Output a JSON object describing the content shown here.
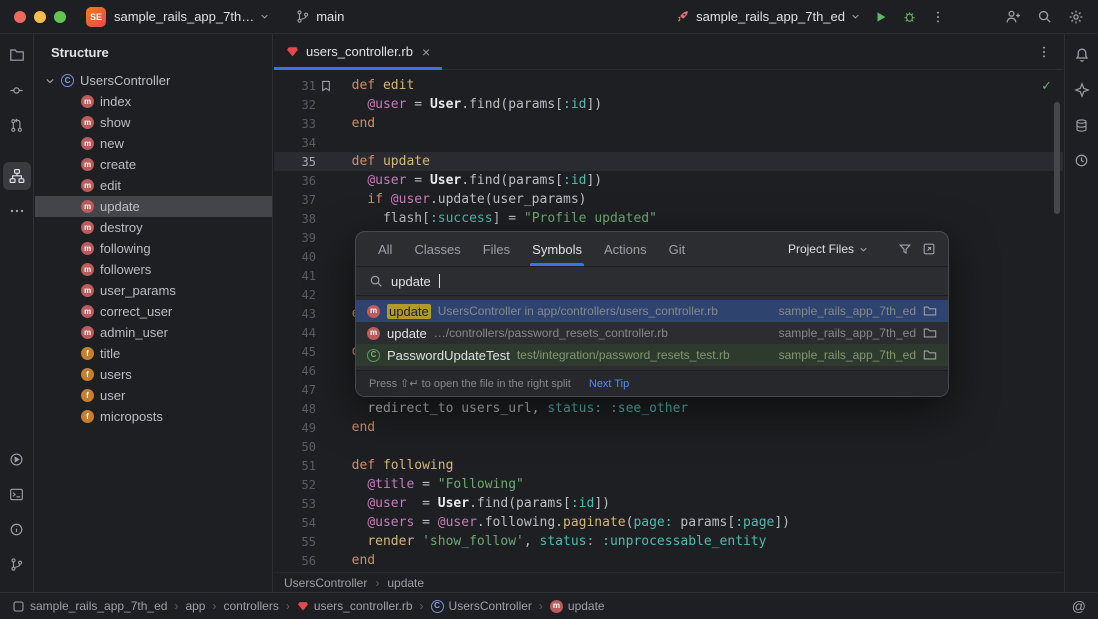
{
  "titlebar": {
    "project_badge": "SE",
    "project_name": "sample_rails_app_7th…",
    "branch": "main",
    "run_config": "sample_rails_app_7th_ed"
  },
  "icons": {
    "left_stripe_top": [
      "project",
      "commit",
      "pull-requests",
      "structure",
      "more"
    ],
    "left_stripe_bottom": [
      "run",
      "terminal",
      "problems",
      "git"
    ],
    "right_stripe": [
      "notifications",
      "ai-assistant",
      "database",
      "history"
    ],
    "titlebar_right": [
      "run-config",
      "run",
      "debug",
      "more",
      "add-user",
      "search",
      "settings"
    ]
  },
  "structure": {
    "title": "Structure",
    "root": {
      "label": "UsersController",
      "icon": "class"
    },
    "items": [
      {
        "label": "index",
        "icon": "method"
      },
      {
        "label": "show",
        "icon": "method"
      },
      {
        "label": "new",
        "icon": "method"
      },
      {
        "label": "create",
        "icon": "method"
      },
      {
        "label": "edit",
        "icon": "method"
      },
      {
        "label": "update",
        "icon": "method",
        "selected": true
      },
      {
        "label": "destroy",
        "icon": "method"
      },
      {
        "label": "following",
        "icon": "method"
      },
      {
        "label": "followers",
        "icon": "method"
      },
      {
        "label": "user_params",
        "icon": "method"
      },
      {
        "label": "correct_user",
        "icon": "method"
      },
      {
        "label": "admin_user",
        "icon": "method"
      },
      {
        "label": "title",
        "icon": "field"
      },
      {
        "label": "users",
        "icon": "field"
      },
      {
        "label": "user",
        "icon": "field"
      },
      {
        "label": "microposts",
        "icon": "field"
      }
    ]
  },
  "editor": {
    "tab_label": "users_controller.rb",
    "breadcrumb": {
      "class": "UsersController",
      "method": "update"
    },
    "lines": [
      {
        "n": 31,
        "bookmark": true,
        "segs": [
          {
            "t": "  ",
            "c": "pl"
          },
          {
            "t": "def ",
            "c": "kw"
          },
          {
            "t": "edit",
            "c": "fn"
          }
        ]
      },
      {
        "n": 32,
        "segs": [
          {
            "t": "    ",
            "c": "pl"
          },
          {
            "t": "@user",
            "c": "ivar"
          },
          {
            "t": " = ",
            "c": "pl"
          },
          {
            "t": "User",
            "c": "const"
          },
          {
            "t": ".find(params[",
            "c": "pl"
          },
          {
            "t": ":id",
            "c": "sym"
          },
          {
            "t": "])",
            "c": "pl"
          }
        ]
      },
      {
        "n": 33,
        "segs": [
          {
            "t": "  ",
            "c": "pl"
          },
          {
            "t": "end",
            "c": "kw"
          }
        ]
      },
      {
        "n": 34,
        "segs": []
      },
      {
        "n": 35,
        "current": true,
        "segs": [
          {
            "t": "  ",
            "c": "pl"
          },
          {
            "t": "def ",
            "c": "kw"
          },
          {
            "t": "update",
            "c": "fn"
          }
        ]
      },
      {
        "n": 36,
        "segs": [
          {
            "t": "    ",
            "c": "pl"
          },
          {
            "t": "@user",
            "c": "ivar"
          },
          {
            "t": " = ",
            "c": "pl"
          },
          {
            "t": "User",
            "c": "const"
          },
          {
            "t": ".find(params[",
            "c": "pl"
          },
          {
            "t": ":id",
            "c": "sym"
          },
          {
            "t": "])",
            "c": "pl"
          }
        ]
      },
      {
        "n": 37,
        "segs": [
          {
            "t": "    ",
            "c": "pl"
          },
          {
            "t": "if ",
            "c": "kw"
          },
          {
            "t": "@user",
            "c": "ivar"
          },
          {
            "t": ".update(user_params)",
            "c": "pl"
          }
        ]
      },
      {
        "n": 38,
        "segs": [
          {
            "t": "      ",
            "c": "pl"
          },
          {
            "t": "flash[",
            "c": "pl"
          },
          {
            "t": ":success",
            "c": "sym"
          },
          {
            "t": "] = ",
            "c": "pl"
          },
          {
            "t": "\"Profile updated\"",
            "c": "str"
          }
        ]
      },
      {
        "n": 39,
        "segs": []
      },
      {
        "n": 40,
        "segs": []
      },
      {
        "n": 41,
        "segs": []
      },
      {
        "n": 42,
        "segs": []
      },
      {
        "n": 43,
        "segs": [
          {
            "t": "  ",
            "c": "pl"
          },
          {
            "t": "e",
            "c": "kw"
          }
        ]
      },
      {
        "n": 44,
        "segs": []
      },
      {
        "n": 45,
        "segs": [
          {
            "t": "  ",
            "c": "pl"
          },
          {
            "t": "d",
            "c": "kw"
          }
        ]
      },
      {
        "n": 46,
        "segs": []
      },
      {
        "n": 47,
        "segs": []
      },
      {
        "n": 48,
        "segs": [
          {
            "t": "    ",
            "c": "pl"
          },
          {
            "t": "redirect_to users_url, ",
            "c": "pl"
          },
          {
            "t": "status: ",
            "c": "sym"
          },
          {
            "t": ":see_other",
            "c": "sym"
          }
        ]
      },
      {
        "n": 49,
        "segs": [
          {
            "t": "  ",
            "c": "pl"
          },
          {
            "t": "end",
            "c": "kw"
          }
        ]
      },
      {
        "n": 50,
        "segs": []
      },
      {
        "n": 51,
        "segs": [
          {
            "t": "  ",
            "c": "pl"
          },
          {
            "t": "def ",
            "c": "kw"
          },
          {
            "t": "following",
            "c": "fn"
          }
        ]
      },
      {
        "n": 52,
        "segs": [
          {
            "t": "    ",
            "c": "pl"
          },
          {
            "t": "@title",
            "c": "ivar"
          },
          {
            "t": " = ",
            "c": "pl"
          },
          {
            "t": "\"Following\"",
            "c": "str"
          }
        ]
      },
      {
        "n": 53,
        "segs": [
          {
            "t": "    ",
            "c": "pl"
          },
          {
            "t": "@user",
            "c": "ivar"
          },
          {
            "t": "  = ",
            "c": "pl"
          },
          {
            "t": "User",
            "c": "const"
          },
          {
            "t": ".find(params[",
            "c": "pl"
          },
          {
            "t": ":id",
            "c": "sym"
          },
          {
            "t": "])",
            "c": "pl"
          }
        ]
      },
      {
        "n": 54,
        "segs": [
          {
            "t": "    ",
            "c": "pl"
          },
          {
            "t": "@users",
            "c": "ivar"
          },
          {
            "t": " = ",
            "c": "pl"
          },
          {
            "t": "@user",
            "c": "ivar"
          },
          {
            "t": ".following.",
            "c": "pl"
          },
          {
            "t": "paginate",
            "c": "fn"
          },
          {
            "t": "(",
            "c": "pl"
          },
          {
            "t": "page: ",
            "c": "sym"
          },
          {
            "t": "params[",
            "c": "pl"
          },
          {
            "t": ":page",
            "c": "sym"
          },
          {
            "t": "])",
            "c": "pl"
          }
        ]
      },
      {
        "n": 55,
        "segs": [
          {
            "t": "    ",
            "c": "pl"
          },
          {
            "t": "render ",
            "c": "fn"
          },
          {
            "t": "'show_follow'",
            "c": "str"
          },
          {
            "t": ", ",
            "c": "pl"
          },
          {
            "t": "status: ",
            "c": "sym"
          },
          {
            "t": ":unprocessable_entity",
            "c": "sym"
          }
        ]
      },
      {
        "n": 56,
        "segs": [
          {
            "t": "  ",
            "c": "pl"
          },
          {
            "t": "end",
            "c": "kw"
          }
        ]
      }
    ]
  },
  "popup": {
    "tabs": [
      "All",
      "Classes",
      "Files",
      "Symbols",
      "Actions",
      "Git"
    ],
    "active_tab": "Symbols",
    "scope_label": "Project Files",
    "query": "update",
    "results": [
      {
        "icon": "method",
        "name": "update",
        "match": true,
        "detail": "UsersController in app/controllers/users_controller.rb",
        "project": "sample_rails_app_7th_ed",
        "selected": true
      },
      {
        "icon": "method",
        "name": "update",
        "detail": "…/controllers/password_resets_controller.rb",
        "project": "sample_rails_app_7th_ed"
      },
      {
        "icon": "test-class",
        "name": "PasswordUpdateTest",
        "detail": "test/integration/password_resets_test.rb",
        "project": "sample_rails_app_7th_ed",
        "green": true
      }
    ],
    "footer_hint": "Press ⇧↵ to open the file in the right split",
    "footer_link": "Next Tip"
  },
  "statusbar": {
    "breadcrumbs": [
      {
        "label": "sample_rails_app_7th_ed",
        "icon": "project"
      },
      {
        "label": "app"
      },
      {
        "label": "controllers"
      },
      {
        "label": "users_controller.rb",
        "icon": "ruby-file"
      },
      {
        "label": "UsersController",
        "icon": "class"
      },
      {
        "label": "update",
        "icon": "method"
      }
    ]
  },
  "colors": {
    "accent": "#3574f0",
    "selection": "#2e436e",
    "match_highlight": "#b3982e",
    "run_green": "#5fb865"
  }
}
